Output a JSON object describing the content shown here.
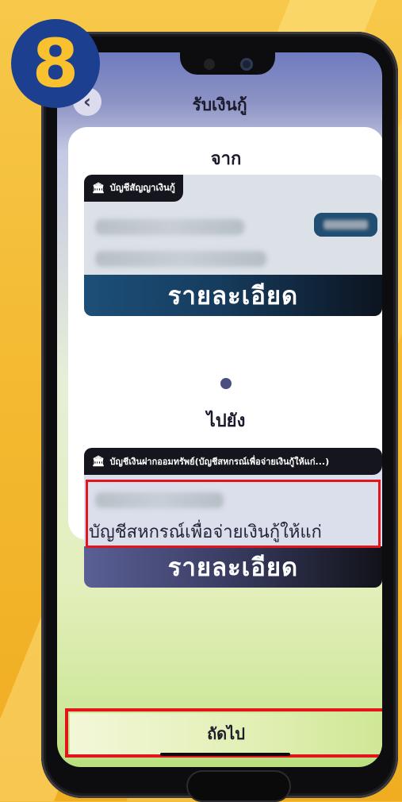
{
  "step_badge": "8",
  "header": {
    "title": "รับเงินกู้",
    "back_icon": "chevron-left-icon"
  },
  "from_section": {
    "label": "จาก",
    "account_tag": "บัญชีสัญญาเงินกู้",
    "details_label": "รายละเอียด"
  },
  "to_section": {
    "label": "ไปยัง",
    "account_tag": "บัญชีเงินฝากออมทรัพย์(บัญชีสหกรณ์เพื่อจ่ายเงินกู้ให้แก่...)",
    "account_name": "บัญชีสหกรณ์เพื่อจ่ายเงินกู้ให้แก่",
    "details_label": "รายละเอียด"
  },
  "footer": {
    "next_label": "ถัดไป"
  },
  "colors": {
    "highlight": "#e3141c",
    "badge_bg": "#1d3f8f",
    "badge_fg": "#f9c12e",
    "background": "#f5bd3a"
  }
}
